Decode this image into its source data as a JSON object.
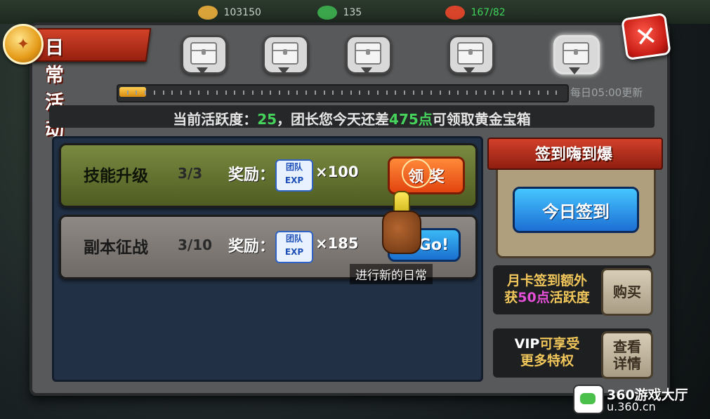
{
  "hud": {
    "resource_1": "103150",
    "resource_2": "135",
    "resource_3": "167/82"
  },
  "header": {
    "title": "日常活动",
    "close_icon": "close-x-icon"
  },
  "activity": {
    "chests": [
      "treasure-chest-icon",
      "treasure-chest-icon",
      "treasure-chest-icon",
      "treasure-chest-icon",
      "gold-treasure-chest-icon"
    ],
    "progress_fraction": 0.06,
    "reset_text": "每日05:00更新",
    "status_prefix": "当前活跃度：",
    "current_points": "25",
    "status_middle": "，团长您今天还差",
    "points_needed": "475点",
    "status_suffix": "可领取黄金宝箱"
  },
  "quests": [
    {
      "name": "技能升级",
      "progress": "3/3",
      "reward_label": "奖励：",
      "reward_icon": "team-exp-icon",
      "reward_icon_text_1": "团队",
      "reward_icon_text_2": "EXP",
      "amount": "×100",
      "button": "领 奖"
    },
    {
      "name": "副本征战",
      "progress": "3/10",
      "reward_label": "奖励：",
      "reward_icon": "team-exp-icon",
      "reward_icon_text_1": "团队",
      "reward_icon_text_2": "EXP",
      "amount": "×185",
      "button": "Go!"
    }
  ],
  "guide": {
    "tip": "进行新的日常"
  },
  "signin": {
    "title": "签到嗨到爆",
    "button": "今日签到"
  },
  "month_card": {
    "line1": "月卡签到额外",
    "line2_prefix": "获",
    "points": "50点",
    "line2_suffix": "活跃度",
    "button": "购买"
  },
  "vip": {
    "prefix": "VIP",
    "line1_rest": "可享受",
    "line2": "更多特权",
    "button_line1": "查看",
    "button_line2": "详情"
  },
  "watermark": {
    "line1": "360游戏大厅",
    "line2": "u.360.cn"
  },
  "colors": {
    "green_highlight": "#46d35c",
    "pink_highlight": "#e54fd8",
    "gold_text": "#f1c75b"
  }
}
